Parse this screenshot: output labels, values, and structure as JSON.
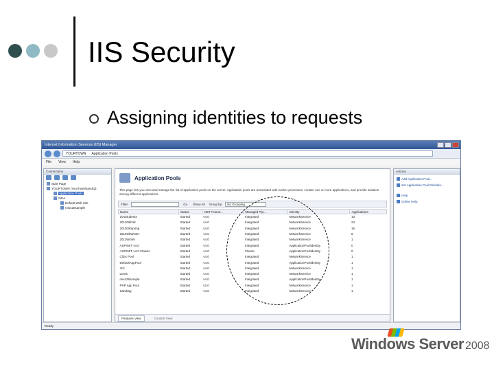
{
  "slide": {
    "title": "IIS Security",
    "bullet": "Assigning identities to requests",
    "dot_colors": [
      "#2f4f4f",
      "#8fbac4",
      "#c8c8c8"
    ]
  },
  "window": {
    "title": "Internet Information Services (IIS) Manager",
    "crumbs": [
      "YOURTOWN",
      "Application Pools"
    ],
    "menu": [
      "File",
      "View",
      "Help"
    ],
    "status": "Ready"
  },
  "connections": {
    "header": "Connections",
    "tree": [
      {
        "label": "Start Page"
      },
      {
        "label": "YOURTOWN (YourTown\\sandrg)"
      },
      {
        "label": "Application Pools",
        "selected": true
      },
      {
        "label": "Sites"
      },
      {
        "label": "Default Web Site"
      },
      {
        "label": "mis425sample"
      }
    ]
  },
  "main": {
    "title": "Application Pools",
    "description": "This page lets you view and manage the list of application pools on the server. Application pools are associated with worker processes, contain one or more applications, and provide isolation among different applications.",
    "filter_label": "Filter:",
    "go_label": "Go",
    "show_all_label": "Show All",
    "group_by_label": "Group by:",
    "group_by_value": "No Grouping",
    "columns": [
      "Name",
      "Status",
      ".NET Frame...",
      "Managed Pip...",
      "Identity",
      "Applications"
    ],
    "rows": [
      [
        "204Students",
        "Started",
        "v4.0",
        "Integrated",
        "NetworkService",
        "10"
      ],
      [
        "2010OkFall",
        "Started",
        "v4.0",
        "Integrated",
        "NetworkService",
        "24"
      ],
      [
        "2010OkSpring",
        "Started",
        "v4.0",
        "Integrated",
        "NetworkService",
        "16"
      ],
      [
        "2010OkWinter",
        "Started",
        "v4.0",
        "Integrated",
        "NetworkService",
        "8"
      ],
      [
        "2011Winter",
        "Started",
        "v4.0",
        "Integrated",
        "NetworkService",
        "1"
      ],
      [
        "ASP.NET v4.0",
        "Started",
        "v4.0",
        "Integrated",
        "ApplicationPoolIdentity",
        "0"
      ],
      [
        "ASP.NET v4.0 Classic",
        "Started",
        "v4.0",
        "Classic",
        "ApplicationPoolIdentity",
        "0"
      ],
      [
        "Cl2Is Pool",
        "Started",
        "v4.0",
        "Integrated",
        "NetworkService",
        "1"
      ],
      [
        "DefaultAppPool",
        "Started",
        "v4.0",
        "Integrated",
        "ApplicationPoolIdentity",
        "1"
      ],
      [
        "ISC",
        "Started",
        "v4.0",
        "Integrated",
        "NetworkService",
        "1"
      ],
      [
        "Lewis",
        "Started",
        "v4.0",
        "Integrated",
        "NetworkService",
        "1"
      ],
      [
        "mis425sample",
        "Started",
        "v4.0",
        "Integrated",
        "ApplicationPoolIdentity",
        "1"
      ],
      [
        "PHP App Pool",
        "Started",
        "v2.0",
        "Integrated",
        "NetworkService",
        "1"
      ],
      [
        "Sandrag",
        "Started",
        "v4.0",
        "Integrated",
        "NetworkService",
        "1"
      ]
    ],
    "views": [
      "Features View",
      "Content View"
    ]
  },
  "actions": {
    "header": "Actions",
    "items": [
      {
        "label": "Add Application Pool...",
        "icon": "add-icon"
      },
      {
        "label": "Set Application Pool Defaults...",
        "icon": "settings-icon"
      },
      {
        "label": "Help",
        "icon": "help-icon"
      },
      {
        "label": "Online Help",
        "icon": "globe-icon"
      }
    ]
  },
  "logo": {
    "text": "Windows Server",
    "year": "2008"
  }
}
